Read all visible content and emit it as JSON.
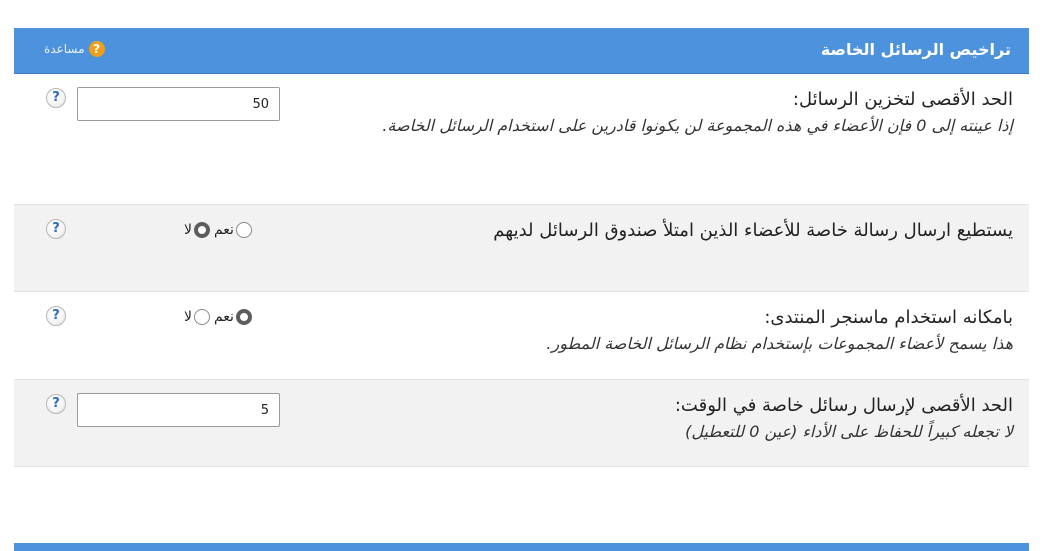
{
  "header": {
    "title": "تراخيص الرسائل الخاصة",
    "help_label": "مساعدة",
    "help_icon": "help-icon"
  },
  "rows": [
    {
      "label": "الحد الأقصى لتخزين الرسائل:",
      "description": "إذا عينته إلى 0 فإن الأعضاء في هذه المجموعة لن يكونوا قادرين على استخدام الرسائل الخاصة.",
      "value": "50"
    },
    {
      "label": "يستطيع ارسال رسالة خاصة للأعضاء الذين امتلأ صندوق الرسائل لديهم",
      "yes_label": "نعم",
      "no_label": "لا",
      "selected": "no"
    },
    {
      "label": "بامكانه استخدام ماسنجر المنتدى:",
      "description": "هذا يسمح لأعضاء المجموعات بإستخدام نظام الرسائل الخاصة المطور.",
      "yes_label": "نعم",
      "no_label": "لا",
      "selected": "yes"
    },
    {
      "label": "الحد الأقصى لإرسال رسائل خاصة في الوقت:",
      "description": "لا تجعله كبيراً للحفاظ على الأداء (عين 0 للتعطيل)",
      "value": "5"
    }
  ],
  "colors": {
    "header": "#4d92dd",
    "alt_row": "#f2f2f2",
    "help_badge": "#f0a018"
  }
}
